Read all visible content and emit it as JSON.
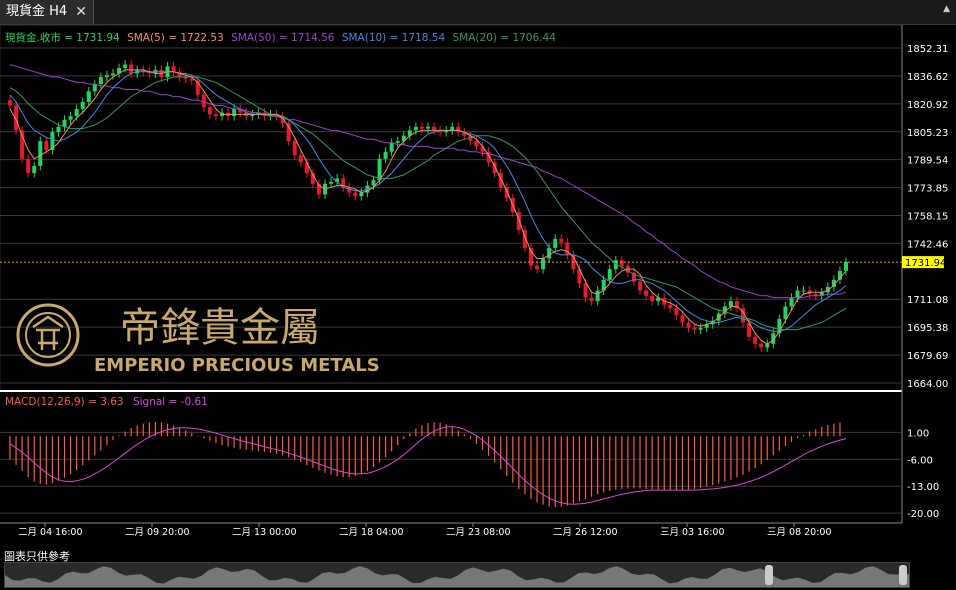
{
  "tab": {
    "title": "現貨金 H4",
    "close": "✕"
  },
  "legend": {
    "close": {
      "label": "現貨金.收市 = 1731.94",
      "color": "#22d65a"
    },
    "sma5": {
      "label": "SMA(5) = 1722.53",
      "color": "#f08c5a"
    },
    "sma50": {
      "label": "SMA(50) = 1714.56",
      "color": "#a040d0"
    },
    "sma10": {
      "label": "SMA(10) = 1718.54",
      "color": "#3d8be0"
    },
    "sma20": {
      "label": "SMA(20) = 1706.44",
      "color": "#2e9a60"
    }
  },
  "macd_legend": {
    "macd": "MACD(12,26,9) = 3.63",
    "signal": "Signal = -0.61",
    "macd_color": "#ff5a3c",
    "signal_color": "#e040e0"
  },
  "watermark": {
    "chinese": "帝鋒貴金屬",
    "english": "EMPERIO PRECIOUS METALS",
    "color": "#c8a96a"
  },
  "last_price": "1731.94",
  "footer": "圖表只供參考",
  "chart_data": [
    {
      "type": "candlestick",
      "title": "現貨金 H4",
      "y_ticks": [
        "1852.31",
        "1836.62",
        "1820.92",
        "1805.23",
        "1789.54",
        "1773.85",
        "1758.15",
        "1742.46",
        "1711.08",
        "1695.38",
        "1679.69",
        "1664.00"
      ],
      "ylim": [
        1664.0,
        1852.31
      ],
      "grid": true,
      "current_price": 1731.94,
      "close": [
        1820,
        1806,
        1790,
        1782,
        1786,
        1800,
        1795,
        1805,
        1808,
        1812,
        1814,
        1818,
        1822,
        1828,
        1832,
        1836,
        1837,
        1838,
        1841,
        1843,
        1838,
        1840,
        1839,
        1838,
        1840,
        1836,
        1842,
        1839,
        1836,
        1835,
        1834,
        1826,
        1819,
        1815,
        1814,
        1816,
        1814,
        1818,
        1816,
        1814,
        1815,
        1816,
        1814,
        1815,
        1814,
        1810,
        1800,
        1792,
        1788,
        1782,
        1776,
        1770,
        1776,
        1777,
        1779,
        1774,
        1771,
        1769,
        1771,
        1775,
        1778,
        1790,
        1794,
        1799,
        1800,
        1803,
        1806,
        1808,
        1807,
        1808,
        1806,
        1805,
        1806,
        1808,
        1805,
        1803,
        1800,
        1797,
        1794,
        1788,
        1782,
        1774,
        1768,
        1760,
        1750,
        1740,
        1730,
        1728,
        1734,
        1740,
        1745,
        1743,
        1736,
        1728,
        1720,
        1712,
        1710,
        1716,
        1722,
        1728,
        1733,
        1730,
        1726,
        1721,
        1716,
        1713,
        1710,
        1712,
        1708,
        1706,
        1702,
        1698,
        1695,
        1694,
        1695,
        1697,
        1699,
        1703,
        1707,
        1710,
        1706,
        1698,
        1690,
        1686,
        1684,
        1686,
        1692,
        1700,
        1707,
        1712,
        1716,
        1716,
        1714,
        1713,
        1715,
        1718,
        1722,
        1727,
        1732
      ],
      "sma5": [
        1818,
        1812,
        1803,
        1795,
        1790,
        1792,
        1794,
        1796,
        1799,
        1804,
        1809,
        1813,
        1816,
        1820,
        1824,
        1829,
        1833,
        1836,
        1838,
        1840,
        1840,
        1840,
        1840,
        1839,
        1838,
        1838,
        1839,
        1839,
        1838,
        1837,
        1836,
        1833,
        1828,
        1823,
        1818,
        1815,
        1815,
        1815,
        1815,
        1815,
        1815,
        1815,
        1815,
        1815,
        1815,
        1813,
        1808,
        1802,
        1795,
        1788,
        1781,
        1775,
        1773,
        1774,
        1775,
        1775,
        1774,
        1773,
        1771,
        1772,
        1774,
        1778,
        1783,
        1790,
        1796,
        1800,
        1803,
        1805,
        1806,
        1806,
        1806,
        1806,
        1806,
        1806,
        1806,
        1805,
        1803,
        1801,
        1797,
        1792,
        1786,
        1779,
        1772,
        1764,
        1756,
        1746,
        1738,
        1734,
        1734,
        1736,
        1738,
        1739,
        1738,
        1735,
        1728,
        1721,
        1715,
        1714,
        1716,
        1720,
        1724,
        1727,
        1728,
        1728,
        1725,
        1719,
        1715,
        1712,
        1710,
        1709,
        1707,
        1704,
        1700,
        1697,
        1696,
        1697,
        1698,
        1701,
        1704,
        1707,
        1707,
        1704,
        1698,
        1692,
        1688,
        1686,
        1688,
        1693,
        1699,
        1705,
        1711,
        1714,
        1715,
        1715,
        1715,
        1716,
        1719,
        1723,
        1727
      ],
      "sma10": [
        1826,
        1822,
        1816,
        1810,
        1806,
        1804,
        1802,
        1801,
        1800,
        1801,
        1803,
        1805,
        1808,
        1812,
        1816,
        1821,
        1826,
        1830,
        1833,
        1836,
        1838,
        1839,
        1839,
        1839,
        1839,
        1839,
        1839,
        1839,
        1838,
        1838,
        1837,
        1835,
        1832,
        1829,
        1826,
        1824,
        1822,
        1820,
        1818,
        1816,
        1815,
        1815,
        1815,
        1815,
        1815,
        1814,
        1812,
        1809,
        1805,
        1801,
        1796,
        1790,
        1785,
        1780,
        1777,
        1774,
        1773,
        1772,
        1772,
        1773,
        1774,
        1776,
        1779,
        1782,
        1786,
        1790,
        1794,
        1798,
        1801,
        1804,
        1805,
        1806,
        1806,
        1806,
        1806,
        1805,
        1804,
        1803,
        1801,
        1799,
        1796,
        1791,
        1786,
        1780,
        1773,
        1766,
        1758,
        1751,
        1745,
        1740,
        1737,
        1736,
        1736,
        1736,
        1735,
        1733,
        1729,
        1726,
        1723,
        1721,
        1720,
        1720,
        1721,
        1722,
        1722,
        1721,
        1720,
        1718,
        1716,
        1713,
        1710,
        1707,
        1704,
        1702,
        1700,
        1699,
        1698,
        1698,
        1699,
        1700,
        1701,
        1700,
        1699,
        1697,
        1695,
        1694,
        1693,
        1693,
        1694,
        1696,
        1699,
        1702,
        1705,
        1708,
        1710,
        1712,
        1714,
        1716,
        1719
      ],
      "sma20": [
        1830,
        1828,
        1825,
        1821,
        1818,
        1815,
        1813,
        1811,
        1809,
        1808,
        1807,
        1807,
        1807,
        1808,
        1809,
        1811,
        1813,
        1816,
        1819,
        1822,
        1825,
        1827,
        1829,
        1831,
        1833,
        1834,
        1835,
        1836,
        1836,
        1836,
        1836,
        1836,
        1835,
        1834,
        1833,
        1831,
        1829,
        1827,
        1825,
        1823,
        1821,
        1819,
        1817,
        1815,
        1814,
        1813,
        1812,
        1810,
        1808,
        1806,
        1804,
        1801,
        1798,
        1795,
        1792,
        1789,
        1787,
        1785,
        1783,
        1781,
        1780,
        1779,
        1779,
        1779,
        1780,
        1781,
        1783,
        1785,
        1787,
        1789,
        1792,
        1794,
        1796,
        1798,
        1800,
        1801,
        1802,
        1803,
        1803,
        1803,
        1802,
        1801,
        1799,
        1797,
        1794,
        1791,
        1787,
        1783,
        1778,
        1773,
        1768,
        1763,
        1759,
        1755,
        1751,
        1747,
        1743,
        1740,
        1737,
        1734,
        1731,
        1729,
        1727,
        1725,
        1724,
        1723,
        1722,
        1721,
        1720,
        1719,
        1718,
        1716,
        1714,
        1712,
        1710,
        1708,
        1706,
        1705,
        1704,
        1703,
        1702,
        1701,
        1700,
        1699,
        1697,
        1696,
        1695,
        1694,
        1694,
        1694,
        1694,
        1695,
        1696,
        1697,
        1698,
        1700,
        1702,
        1704,
        1706
      ],
      "sma50": [
        1843,
        1842,
        1841,
        1840,
        1839,
        1838,
        1837,
        1836,
        1836,
        1835,
        1834,
        1833,
        1833,
        1832,
        1832,
        1831,
        1831,
        1830,
        1830,
        1829,
        1829,
        1829,
        1828,
        1828,
        1827,
        1826,
        1826,
        1825,
        1825,
        1824,
        1823,
        1823,
        1822,
        1821,
        1820,
        1820,
        1819,
        1818,
        1818,
        1817,
        1816,
        1816,
        1815,
        1814,
        1814,
        1813,
        1812,
        1812,
        1811,
        1810,
        1809,
        1808,
        1807,
        1806,
        1806,
        1805,
        1804,
        1803,
        1802,
        1801,
        1801,
        1800,
        1799,
        1799,
        1798,
        1798,
        1797,
        1797,
        1797,
        1797,
        1796,
        1796,
        1796,
        1796,
        1795,
        1795,
        1794,
        1794,
        1793,
        1793,
        1792,
        1791,
        1790,
        1789,
        1788,
        1787,
        1786,
        1785,
        1783,
        1782,
        1780,
        1779,
        1777,
        1775,
        1773,
        1771,
        1769,
        1767,
        1765,
        1763,
        1761,
        1759,
        1757,
        1754,
        1752,
        1749,
        1747,
        1744,
        1742,
        1739,
        1737,
        1734,
        1732,
        1730,
        1727,
        1725,
        1723,
        1721,
        1720,
        1718,
        1717,
        1716,
        1715,
        1714,
        1713,
        1713,
        1712,
        1712,
        1712,
        1712,
        1712,
        1712,
        1713,
        1713,
        1713,
        1714,
        1714,
        1714,
        1715
      ]
    },
    {
      "type": "macd",
      "title": "MACD(12,26,9)",
      "y_ticks": [
        "1.00",
        "-6.00",
        "-13.00",
        "-20.00"
      ],
      "ylim": [
        -21,
        5
      ],
      "x_ticks": [
        "二月 04 16:00",
        "二月 09 20:00",
        "二月 13 00:00",
        "二月 18 04:00",
        "二月 23 08:00",
        "二月 26 12:00",
        "三月 03 16:00",
        "三月 08 20:00"
      ],
      "macd": [
        -6.0,
        -7.4,
        -9.0,
        -10.6,
        -11.8,
        -12.4,
        -12.6,
        -12.2,
        -11.6,
        -10.8,
        -9.9,
        -8.8,
        -7.6,
        -6.3,
        -5.0,
        -3.7,
        -2.3,
        -1.0,
        0.2,
        1.2,
        2.1,
        2.8,
        3.3,
        3.6,
        3.7,
        3.6,
        3.3,
        2.8,
        2.2,
        1.5,
        0.8,
        0.1,
        -0.6,
        -1.2,
        -1.8,
        -2.3,
        -2.7,
        -3.0,
        -3.3,
        -3.5,
        -3.7,
        -3.9,
        -4.1,
        -4.3,
        -4.6,
        -5.0,
        -5.5,
        -6.1,
        -6.8,
        -7.5,
        -8.2,
        -8.9,
        -9.5,
        -10.0,
        -10.4,
        -10.6,
        -10.6,
        -10.3,
        -9.8,
        -9.0,
        -8.0,
        -6.8,
        -5.4,
        -3.9,
        -2.3,
        -0.7,
        0.8,
        2.0,
        2.9,
        3.4,
        3.6,
        3.5,
        3.1,
        2.4,
        1.5,
        0.5,
        -0.7,
        -2.0,
        -3.5,
        -5.1,
        -6.8,
        -8.6,
        -10.4,
        -12.1,
        -13.7,
        -15.1,
        -16.3,
        -17.2,
        -17.8,
        -18.2,
        -18.4,
        -18.3,
        -18.0,
        -17.5,
        -16.9,
        -16.3,
        -15.7,
        -15.1,
        -14.6,
        -14.2,
        -13.9,
        -13.7,
        -13.6,
        -13.6,
        -13.6,
        -13.7,
        -13.8,
        -13.9,
        -14.0,
        -14.0,
        -14.0,
        -14.0,
        -13.9,
        -13.7,
        -13.4,
        -13.1,
        -12.7,
        -12.3,
        -11.8,
        -11.3,
        -10.7,
        -10.0,
        -9.2,
        -8.3,
        -7.3,
        -6.2,
        -5.0,
        -3.8,
        -2.6,
        -1.5,
        -0.5,
        0.4,
        1.2,
        1.8,
        2.4,
        2.9,
        3.3,
        3.63
      ],
      "signal": [
        -2.0,
        -3.0,
        -4.2,
        -5.5,
        -6.9,
        -8.3,
        -9.5,
        -10.6,
        -11.3,
        -11.7,
        -11.8,
        -11.6,
        -11.2,
        -10.6,
        -9.8,
        -8.9,
        -7.9,
        -6.8,
        -5.6,
        -4.4,
        -3.2,
        -2.1,
        -1.1,
        -0.2,
        0.6,
        1.2,
        1.7,
        2.0,
        2.2,
        2.2,
        2.1,
        1.9,
        1.6,
        1.2,
        0.8,
        0.3,
        -0.2,
        -0.6,
        -1.1,
        -1.5,
        -1.9,
        -2.3,
        -2.7,
        -3.1,
        -3.5,
        -3.9,
        -4.4,
        -4.9,
        -5.4,
        -6.0,
        -6.6,
        -7.2,
        -7.8,
        -8.4,
        -8.9,
        -9.3,
        -9.6,
        -9.8,
        -9.8,
        -9.6,
        -9.2,
        -8.6,
        -7.9,
        -7.0,
        -6.0,
        -4.8,
        -3.5,
        -2.1,
        -0.8,
        0.4,
        1.3,
        2.0,
        2.4,
        2.5,
        2.3,
        1.8,
        1.0,
        0.1,
        -1.0,
        -2.3,
        -3.7,
        -5.2,
        -6.8,
        -8.4,
        -10.0,
        -11.5,
        -12.9,
        -14.1,
        -15.2,
        -16.1,
        -16.8,
        -17.3,
        -17.6,
        -17.7,
        -17.6,
        -17.4,
        -17.1,
        -16.7,
        -16.3,
        -15.9,
        -15.5,
        -15.1,
        -14.8,
        -14.5,
        -14.3,
        -14.1,
        -14.0,
        -14.0,
        -14.0,
        -14.0,
        -14.0,
        -14.0,
        -14.0,
        -14.0,
        -13.9,
        -13.8,
        -13.7,
        -13.5,
        -13.3,
        -13.0,
        -12.7,
        -12.3,
        -11.8,
        -11.3,
        -10.7,
        -10.0,
        -9.2,
        -8.4,
        -7.5,
        -6.6,
        -5.7,
        -4.8,
        -4.0,
        -3.3,
        -2.6,
        -2.0,
        -1.5,
        -1.0,
        -0.61
      ]
    }
  ]
}
